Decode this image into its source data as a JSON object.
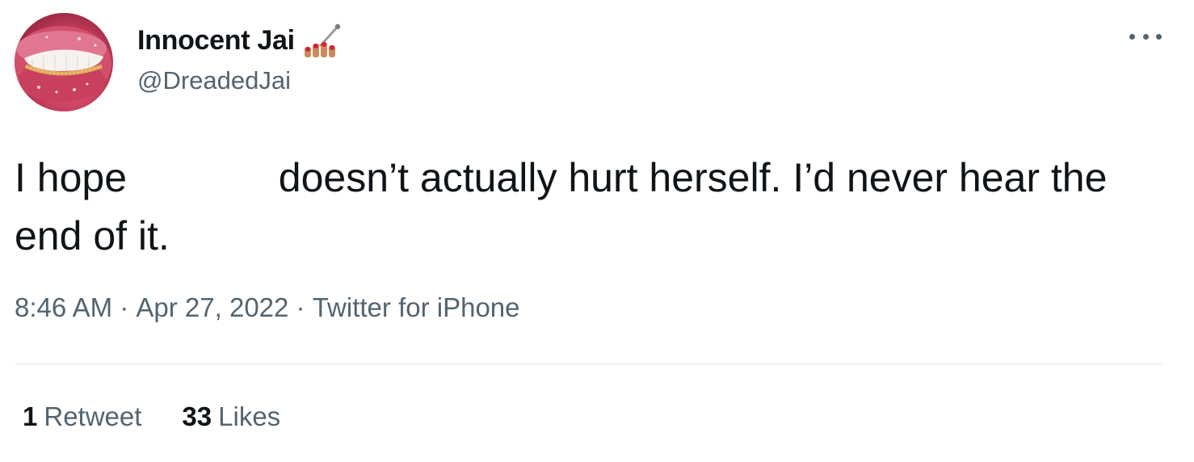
{
  "author": {
    "display_name": "Innocent Jai",
    "handle": "@DreadedJai",
    "badge_icon": "nail-polish-icon"
  },
  "tweet": {
    "text_before_redaction": "I hope ",
    "text_after_redaction": " doesn’t actually hurt herself. I’d never hear the end of it.",
    "time": "8:46 AM",
    "separator": " · ",
    "date": "Apr 27, 2022",
    "source": "Twitter for iPhone"
  },
  "stats": {
    "retweets_count": "1",
    "retweets_label": "Retweet",
    "likes_count": "33",
    "likes_label": "Likes"
  },
  "colors": {
    "text_primary": "#0f1419",
    "text_secondary": "#536471",
    "divider": "#e6ebee"
  }
}
